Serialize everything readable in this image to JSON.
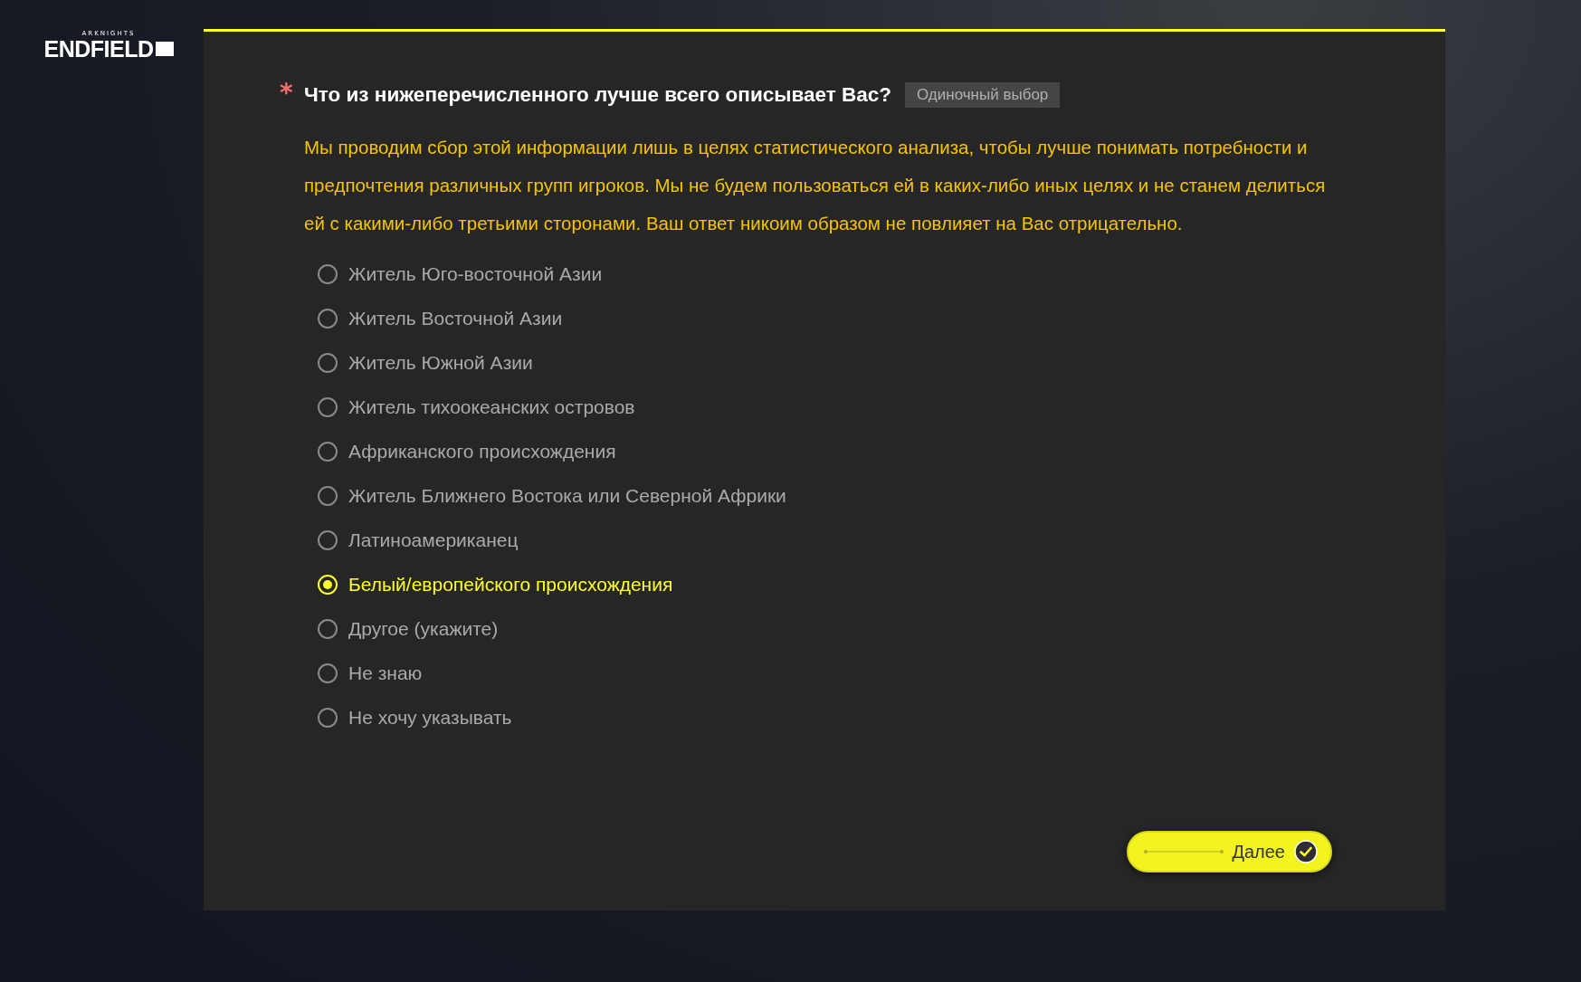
{
  "logo": {
    "subtitle": "ARKNIGHTS",
    "title": "ENDFIELD"
  },
  "question": {
    "required": true,
    "asterisk": "*",
    "title": "Что из нижеперечисленного лучше всего описывает Вас?",
    "tag": "Одиночный выбор",
    "description": "Мы проводим сбор этой информации лишь в целях статистического анализа, чтобы лучше понимать потребности и предпочтения различных групп игроков. Мы не будем пользоваться ей в каких-либо иных целях и не станем делиться ей с какими-либо третьими сторонами. Ваш ответ никоим образом не повлияет на Вас отрицательно.",
    "options": [
      {
        "label": "Житель Юго-восточной Азии",
        "selected": false
      },
      {
        "label": "Житель Восточной Азии",
        "selected": false
      },
      {
        "label": "Житель Южной Азии",
        "selected": false
      },
      {
        "label": "Житель тихоокеанских островов",
        "selected": false
      },
      {
        "label": "Африканского происхождения",
        "selected": false
      },
      {
        "label": "Житель Ближнего Востока или Северной Африки",
        "selected": false
      },
      {
        "label": "Латиноамериканец",
        "selected": false
      },
      {
        "label": "Белый/европейского происхождения",
        "selected": true
      },
      {
        "label": "Другое (укажите)",
        "selected": false
      },
      {
        "label": "Не знаю",
        "selected": false
      },
      {
        "label": "Не хочу указывать",
        "selected": false
      }
    ]
  },
  "next_button": {
    "label": "Далее"
  }
}
